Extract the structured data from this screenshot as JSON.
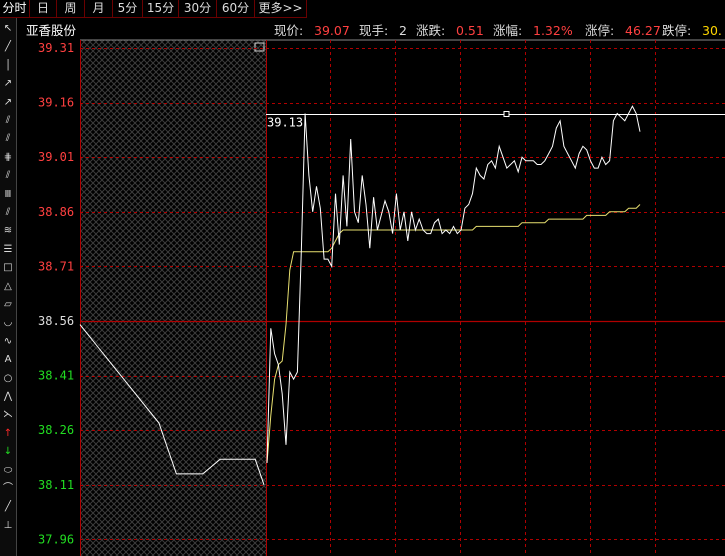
{
  "tabs": [
    {
      "label": "分时",
      "active": true
    },
    {
      "label": "日"
    },
    {
      "label": "周"
    },
    {
      "label": "月"
    },
    {
      "label": "5分"
    },
    {
      "label": "15分"
    },
    {
      "label": "30分"
    },
    {
      "label": "60分"
    },
    {
      "label": "更多>>"
    }
  ],
  "toolbar": {
    "tools": [
      "cursor-tool",
      "line-tool",
      "vertical-line-tool",
      "arrow-line-tool",
      "ray-tool",
      "parallel-line-tool",
      "channel-tool",
      "grid-tool",
      "fan-tool",
      "fibonacci-tool",
      "gann-tool",
      "wave-tool",
      "horizontal-lines-tool",
      "rectangle-tool",
      "triangle-tool",
      "parallelogram-tool",
      "arc-tool",
      "sine-tool",
      "text-tool",
      "circle-tool",
      "zigzag-tool",
      "fork-tool",
      "up-arrow-tool",
      "down-arrow-tool",
      "ellipse-tool",
      "curve-tool",
      "delete-tool",
      "scale-tool"
    ]
  },
  "header": {
    "stock_name": "亚香股份",
    "fields": [
      {
        "label": "现价:",
        "value": "39.07",
        "color": "#ff4040"
      },
      {
        "label": "现手:",
        "value": "2",
        "color": "#dddddd"
      },
      {
        "label": "涨跌:",
        "value": "0.51",
        "color": "#ff4040"
      },
      {
        "label": "涨幅:",
        "value": "1.32%",
        "color": "#ff4040"
      },
      {
        "label": "涨停:",
        "value": "46.27",
        "color": "#ff4040"
      },
      {
        "label": "跌停:",
        "value": "30.",
        "color": "#ffd700"
      }
    ]
  },
  "chart_data": {
    "type": "line",
    "ylim": [
      37.89,
      39.34
    ],
    "y_ticks": [
      {
        "value": 39.31,
        "color": "#ff4040"
      },
      {
        "value": 39.16,
        "color": "#ff4040"
      },
      {
        "value": 39.01,
        "color": "#ff4040"
      },
      {
        "value": 38.86,
        "color": "#ff4040"
      },
      {
        "value": 38.71,
        "color": "#ff4040"
      },
      {
        "value": 38.56,
        "color": "#dddddd"
      },
      {
        "value": 38.41,
        "color": "#22dd22"
      },
      {
        "value": 38.26,
        "color": "#22dd22"
      },
      {
        "value": 38.11,
        "color": "#22dd22"
      },
      {
        "value": 37.96,
        "color": "#22dd22"
      }
    ],
    "prev_close": 38.56,
    "high_label": "39.13",
    "high_value": 39.13,
    "grid": true,
    "colors": {
      "price": "#ffffff",
      "avg": "#e8e070",
      "grid": "#b00000",
      "axis": "#b00000"
    },
    "series": [
      {
        "role": "pre-market",
        "values": [
          38.55,
          38.52,
          38.49,
          38.46,
          38.43,
          38.4,
          38.37,
          38.34,
          38.31,
          38.28,
          38.21,
          38.14,
          38.14,
          38.14,
          38.14,
          38.16,
          38.18,
          38.18,
          38.18,
          38.18,
          38.18,
          38.11
        ]
      },
      {
        "role": "price",
        "values": [
          38.17,
          38.54,
          38.47,
          38.44,
          38.36,
          38.22,
          38.42,
          38.4,
          38.42,
          38.75,
          39.13,
          38.96,
          38.86,
          38.93,
          38.87,
          38.73,
          38.73,
          38.71,
          38.91,
          38.77,
          38.96,
          38.82,
          39.06,
          38.86,
          38.83,
          38.96,
          38.88,
          38.76,
          38.9,
          38.81,
          38.85,
          38.89,
          38.86,
          38.8,
          38.91,
          38.81,
          38.86,
          38.78,
          38.86,
          38.81,
          38.84,
          38.81,
          38.8,
          38.8,
          38.83,
          38.84,
          38.8,
          38.81,
          38.8,
          38.82,
          38.8,
          38.81,
          38.87,
          38.88,
          38.91,
          38.98,
          38.96,
          38.95,
          38.99,
          39.0,
          38.98,
          39.04,
          39.01,
          38.98,
          38.99,
          39.0,
          38.97,
          39.01,
          39.0,
          39.0,
          39.0,
          38.99,
          38.99,
          39.0,
          39.02,
          39.04,
          39.09,
          39.11,
          39.04,
          39.02,
          39.0,
          38.98,
          39.02,
          39.04,
          39.03,
          39.0,
          38.98,
          38.98,
          39.01,
          38.99,
          39.0,
          39.11,
          39.13,
          39.12,
          39.11,
          39.13,
          39.15,
          39.13,
          39.08
        ]
      },
      {
        "role": "average",
        "values": [
          38.17,
          38.3,
          38.4,
          38.44,
          38.45,
          38.55,
          38.7,
          38.75,
          38.75,
          38.75,
          38.75,
          38.75,
          38.75,
          38.75,
          38.75,
          38.75,
          38.75,
          38.76,
          38.78,
          38.8,
          38.81,
          38.81,
          38.81,
          38.81,
          38.81,
          38.81,
          38.81,
          38.81,
          38.81,
          38.81,
          38.81,
          38.81,
          38.81,
          38.81,
          38.81,
          38.81,
          38.81,
          38.81,
          38.81,
          38.81,
          38.81,
          38.81,
          38.81,
          38.81,
          38.81,
          38.81,
          38.81,
          38.81,
          38.81,
          38.81,
          38.81,
          38.81,
          38.81,
          38.81,
          38.81,
          38.82,
          38.82,
          38.82,
          38.82,
          38.82,
          38.82,
          38.82,
          38.82,
          38.82,
          38.82,
          38.82,
          38.82,
          38.83,
          38.83,
          38.83,
          38.83,
          38.83,
          38.83,
          38.83,
          38.84,
          38.84,
          38.84,
          38.84,
          38.84,
          38.84,
          38.84,
          38.84,
          38.84,
          38.84,
          38.85,
          38.85,
          38.85,
          38.85,
          38.85,
          38.85,
          38.86,
          38.86,
          38.86,
          38.86,
          38.86,
          38.87,
          38.87,
          38.87,
          38.88
        ]
      }
    ]
  }
}
